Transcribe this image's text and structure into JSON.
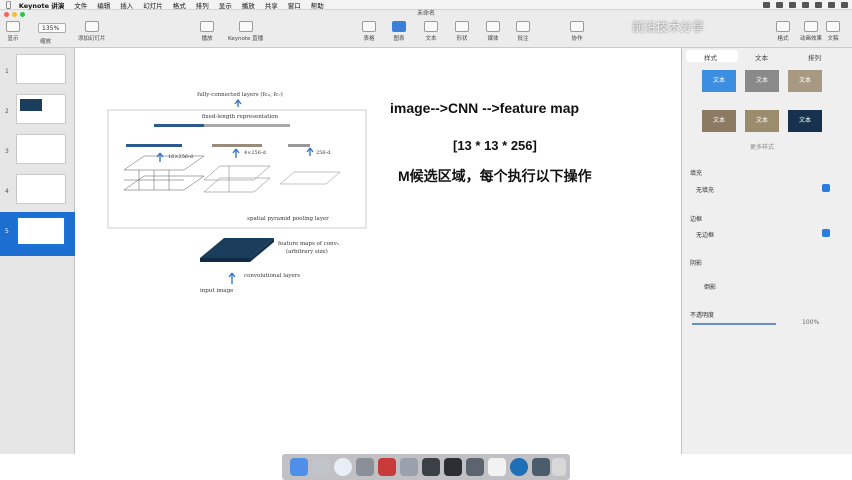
{
  "menubar": {
    "items": [
      "Keynote 讲演",
      "文件",
      "编辑",
      "插入",
      "幻灯片",
      "格式",
      "排列",
      "显示",
      "播放",
      "共享",
      "窗口",
      "帮助"
    ]
  },
  "window": {
    "title": "未命名"
  },
  "toolbar": {
    "zoom": "135%",
    "buttons": [
      {
        "label": "显示"
      },
      {
        "label": "缩放"
      },
      {
        "label": "添加幻灯片"
      },
      {
        "label": "播放"
      },
      {
        "label": "Keynote 直播"
      },
      {
        "label": "表格"
      },
      {
        "label": "图表"
      },
      {
        "label": "文本"
      },
      {
        "label": "形状"
      },
      {
        "label": "媒体"
      },
      {
        "label": "批注"
      },
      {
        "label": "协作"
      },
      {
        "label": "格式"
      },
      {
        "label": "动画效果"
      },
      {
        "label": "文稿"
      }
    ]
  },
  "navigator": {
    "slide_numbers": [
      "1",
      "2",
      "3",
      "4",
      "5"
    ]
  },
  "slide": {
    "heading": "image-->CNN -->feature map",
    "shape": "[13 * 13 * 256]",
    "note": "M候选区域，每个执行以下操作",
    "figure": {
      "fc_label": "fully-connected layers (fc₆, fc₇)",
      "fixed_label": "fixed-length representation",
      "d16": "16×256-d",
      "d4": "4×256-d",
      "d1": "256-d",
      "spp_label": "spatial pyramid pooling layer",
      "fmap_label": "feature maps of conv₅",
      "fmap_label2": "(arbitrary size)",
      "conv_label": "convolutional layers",
      "input_label": "input image"
    }
  },
  "inspector": {
    "tabs": [
      "样式",
      "文本",
      "排列"
    ],
    "swatch_text": "文本",
    "more_styles": "更多样式",
    "fill_title": "填充",
    "fill_value": "无填充",
    "border_title": "边框",
    "border_value": "无边框",
    "shadow_title": "阴影",
    "shadow_item": "倒影",
    "opacity_title": "不透明度",
    "opacity_value": "100%"
  },
  "watermark": "前沿技术分享",
  "colors": {
    "accent": "#1c6fd1",
    "dark_blue": "#1a3d5c"
  }
}
